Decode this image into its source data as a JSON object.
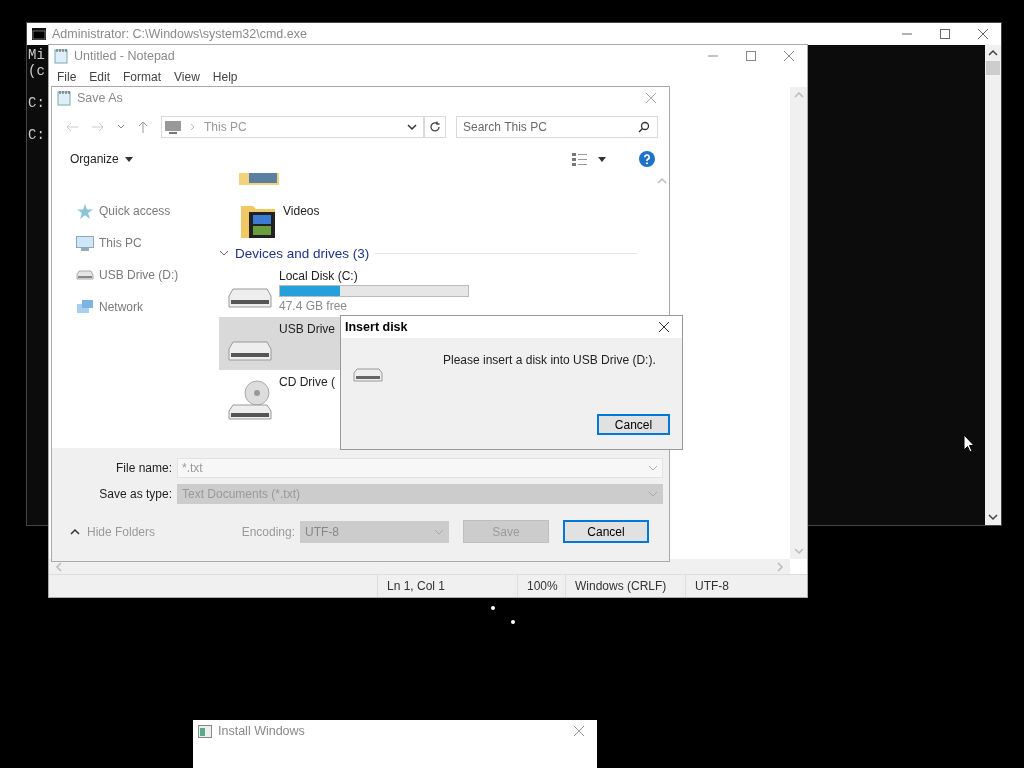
{
  "cmd_window": {
    "title": "Administrator: C:\\Windows\\system32\\cmd.exe",
    "active": false,
    "blocks": [
      [
        "Mi",
        "(c"
      ],
      [
        "C:"
      ],
      [
        "C:"
      ]
    ]
  },
  "notepad": {
    "title": "Untitled - Notepad",
    "active": false,
    "menu": [
      "File",
      "Edit",
      "Format",
      "View",
      "Help"
    ],
    "status_bar": [
      "Ln 1, Col 1",
      "100%",
      "Windows (CRLF)",
      "UTF-8"
    ]
  },
  "save_as": {
    "title": "Save As",
    "active": false,
    "address": "This PC",
    "search": {
      "placeholder": "Search This PC"
    },
    "organize": "Organize",
    "nav_items": [
      {
        "label": "Quick access",
        "kind": "star"
      },
      {
        "label": "This PC",
        "kind": "pc"
      },
      {
        "label": "USB Drive (D:)",
        "kind": "drive"
      },
      {
        "label": "Network",
        "kind": "network"
      }
    ],
    "folders": [
      {
        "label": "Videos"
      }
    ],
    "group": {
      "label": "Devices and drives (3)",
      "expanded": true
    },
    "drives": [
      {
        "label": "Local Disk (C:)",
        "kind": "disk",
        "selected": false,
        "level": 0.32,
        "free": "47.4 GB free"
      },
      {
        "label": "USB Drive",
        "kind": "disk",
        "selected": true
      },
      {
        "label": "CD Drive (",
        "kind": "cd",
        "selected": false
      }
    ],
    "file_name": {
      "label": "File name:",
      "value": "*.txt",
      "disabled": false
    },
    "save_as_type": {
      "label": "Save as type:",
      "value": "Text Documents (*.txt)",
      "disabled": true
    },
    "hide_folders": "Hide Folders",
    "encoding": {
      "label": "Encoding:",
      "value": "UTF-8"
    },
    "buttons": [
      {
        "label": "Save",
        "disabled": true,
        "default": false
      },
      {
        "label": "Cancel",
        "disabled": false,
        "default": true
      }
    ]
  },
  "insert_disk": {
    "title": "Insert disk",
    "active": true,
    "message": "Please insert a disk into USB Drive (D:).",
    "button": "Cancel"
  },
  "install_window": {
    "title": "Install Windows",
    "active": false
  }
}
